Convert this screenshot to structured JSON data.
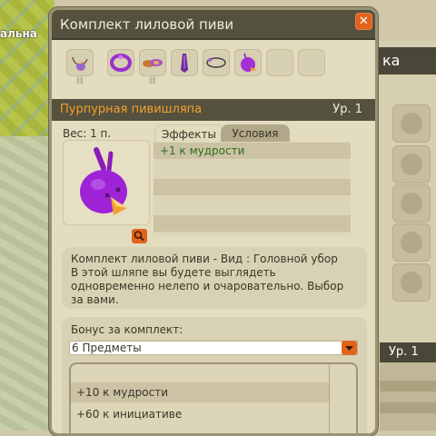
{
  "background": {
    "left_label": "альна",
    "right_header": "ка",
    "right_level": "Ур. 1"
  },
  "window": {
    "title": "Комплект лиловой пиви",
    "close_label": "✕"
  },
  "set_items": [
    {
      "name": "amulet-icon",
      "color": "#9b64c8"
    },
    {
      "name": "belt-icon",
      "color": "#9a2fcf"
    },
    {
      "name": "boots-icon",
      "color": "#c87a2c"
    },
    {
      "name": "cape-icon",
      "color": "#6a2f9a"
    },
    {
      "name": "ring-icon",
      "color": "#5a3a6a"
    },
    {
      "name": "hat-icon",
      "color": "#a32fd6"
    }
  ],
  "selected_item": {
    "name": "Пурпурная пивишляпа",
    "level": "Ур. 1",
    "weight": "Вес: 1 п."
  },
  "tabs": {
    "effects": "Эффекты",
    "conditions": "Условия"
  },
  "effects": [
    "+1 к мудрости"
  ],
  "description": [
    "Комплект лиловой пиви - Вид : Головной убор",
    "В этой шляпе вы будете выглядеть",
    "одновременно нелепо и очаровательно. Выбор",
    "за вами."
  ],
  "bonus": {
    "label": "Бонус за комплект:",
    "selected": "6 Предметы",
    "rows": [
      "+10 к мудрости",
      "+60 к инициативе"
    ]
  },
  "colors": {
    "accent_orange": "#e2631c",
    "item_name": "#f2a02c",
    "effect_green": "#2e6d1e"
  }
}
